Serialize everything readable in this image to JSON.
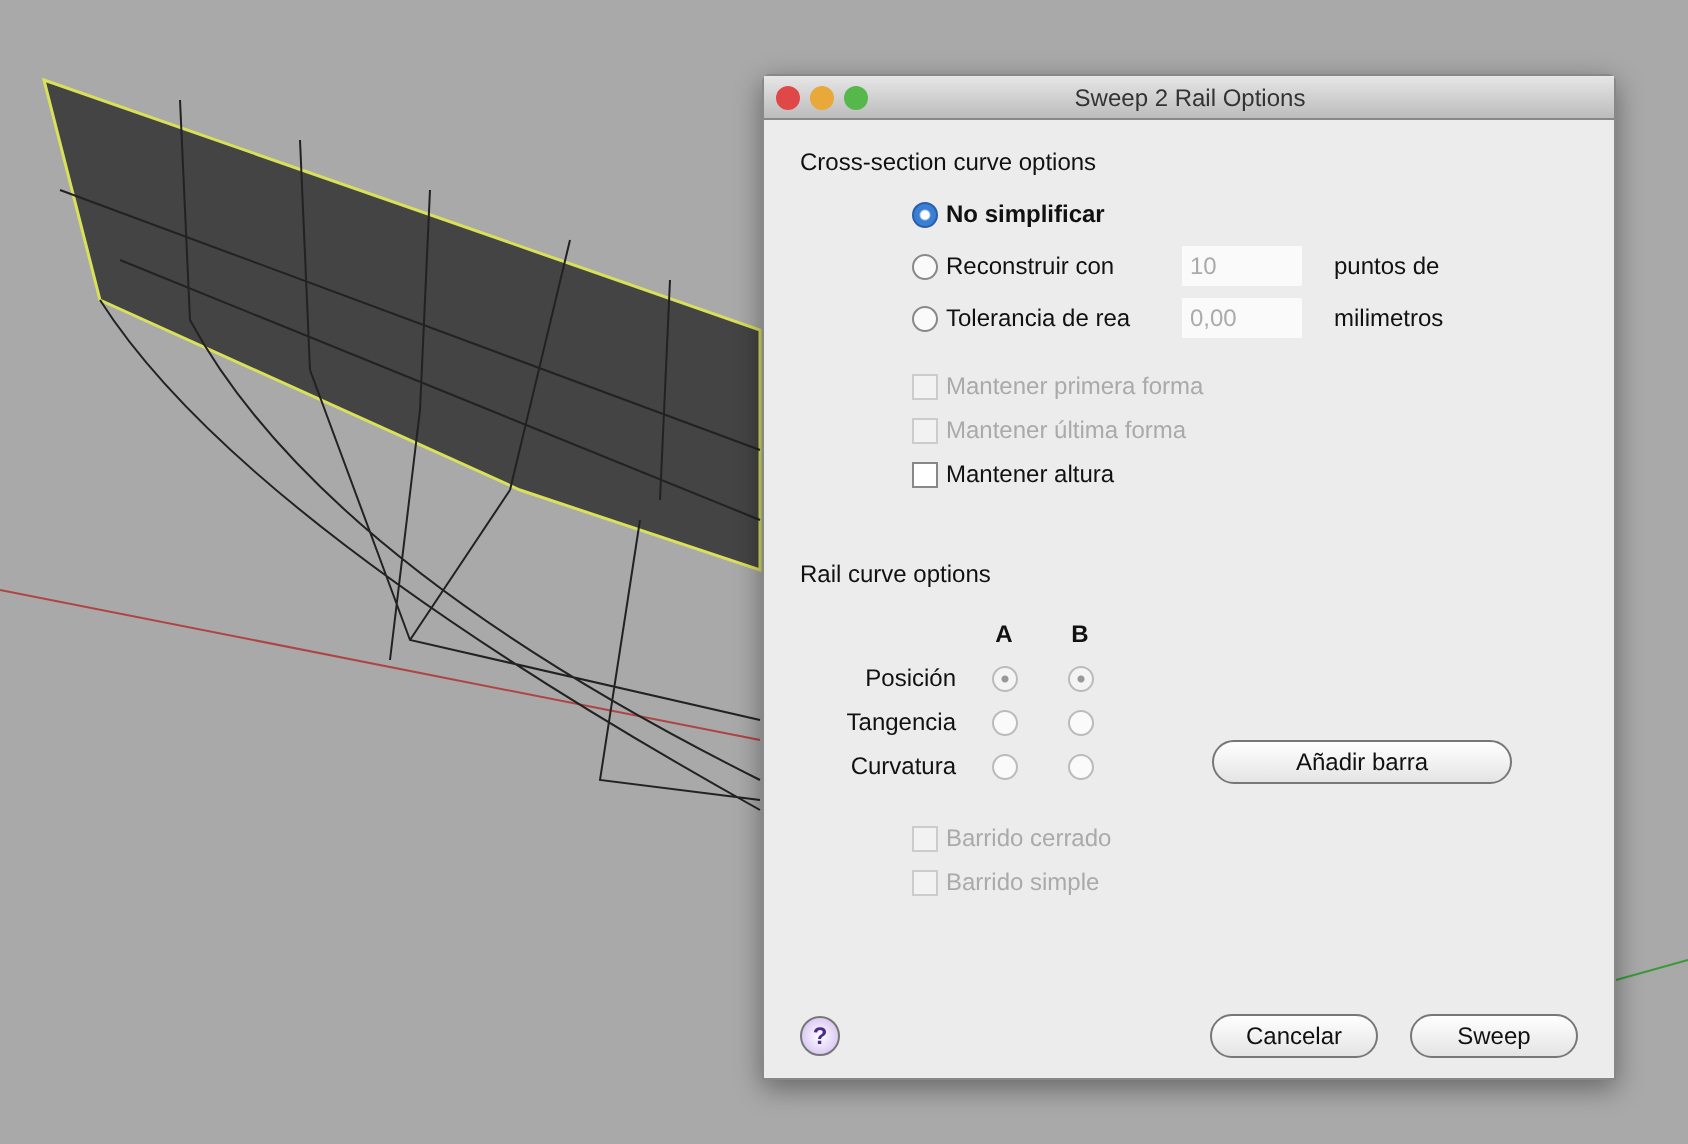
{
  "window": {
    "title": "Sweep 2 Rail Options"
  },
  "cross_section": {
    "heading": "Cross-section curve options",
    "options": [
      {
        "kind": "plain",
        "label": "No simplificar",
        "selected": true
      },
      {
        "kind": "field",
        "label": "Reconstruir con",
        "value": "10",
        "unit": "puntos de",
        "selected": false
      },
      {
        "kind": "field",
        "label": "Tolerancia de rea",
        "value": "0,00",
        "unit": "milimetros",
        "selected": false
      }
    ],
    "checks": [
      {
        "label": "Mantener primera forma",
        "checked": false,
        "disabled": true
      },
      {
        "label": "Mantener última forma",
        "checked": false,
        "disabled": true
      },
      {
        "label": "Mantener altura",
        "checked": false,
        "disabled": false
      }
    ]
  },
  "rail": {
    "heading": "Rail curve options",
    "columns": [
      "A",
      "B"
    ],
    "rows": [
      {
        "label": "Posición",
        "a_selected": true,
        "b_selected": true
      },
      {
        "label": "Tangencia",
        "a_selected": false,
        "b_selected": false
      },
      {
        "label": "Curvatura",
        "a_selected": false,
        "b_selected": false
      }
    ],
    "add_button": "Añadir barra",
    "checks": [
      {
        "label": "Barrido cerrado",
        "checked": false,
        "disabled": true
      },
      {
        "label": "Barrido simple",
        "checked": false,
        "disabled": true
      }
    ]
  },
  "buttons": [
    "Cancelar",
    "Sweep"
  ],
  "help": "?"
}
